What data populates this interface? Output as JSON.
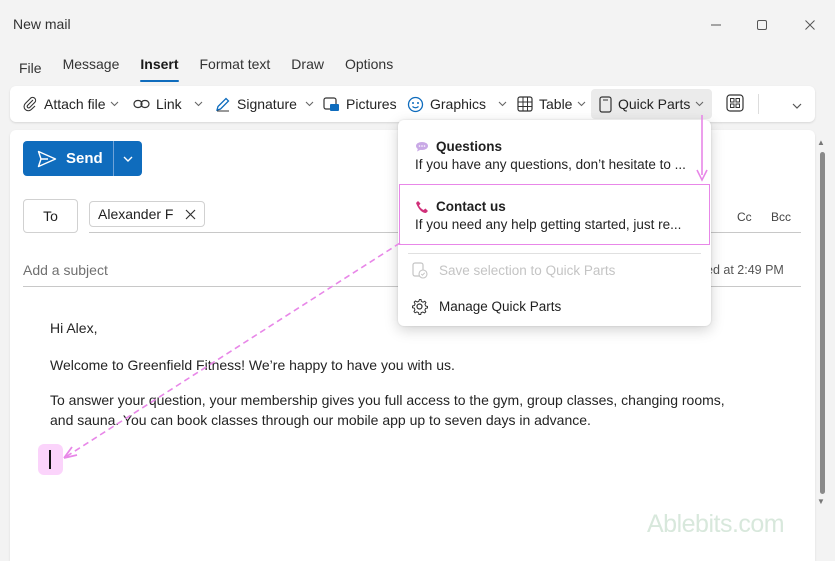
{
  "window": {
    "title": "New mail",
    "controls": [
      "minimize-icon",
      "maximize-icon",
      "close-icon"
    ]
  },
  "menu": {
    "tabs": [
      "File",
      "Message",
      "Insert",
      "Format text",
      "Draw",
      "Options"
    ],
    "active": "Insert"
  },
  "ribbon": {
    "attach_file": "Attach file",
    "link": "Link",
    "signature": "Signature",
    "pictures": "Pictures",
    "graphics": "Graphics",
    "table": "Table",
    "quick_parts": "Quick Parts"
  },
  "compose": {
    "send_label": "Send",
    "to_label": "To",
    "recipient": "Alexander F",
    "cc_label": "Cc",
    "bcc_label": "Bcc",
    "subject_placeholder": "Add a subject",
    "saved_status": "ed at 2:49 PM",
    "body": {
      "greeting": "Hi Alex,",
      "line1": "Welcome to Greenfield Fitness! We’re happy to have you with us.",
      "line2a": "To answer your question, your membership gives you full access to the gym, group classes, changing rooms,",
      "line2b": "and sauna. You can book classes through our mobile app up to seven days in advance."
    }
  },
  "quick_parts_menu": {
    "items": [
      {
        "title": "Questions",
        "description": "If you have any questions, don’t hesitate to ...",
        "icon": "speech-bubble-icon"
      },
      {
        "title": "Contact us",
        "description": "If you need any help getting started, just re...",
        "icon": "phone-icon"
      }
    ],
    "save_selection": "Save selection to Quick Parts",
    "manage": "Manage Quick Parts"
  },
  "watermark": "Ablebits.com",
  "colors": {
    "accent": "#0f6cbd",
    "annotation": "#e887e8",
    "cursor_highlight": "#fbd4fb"
  }
}
